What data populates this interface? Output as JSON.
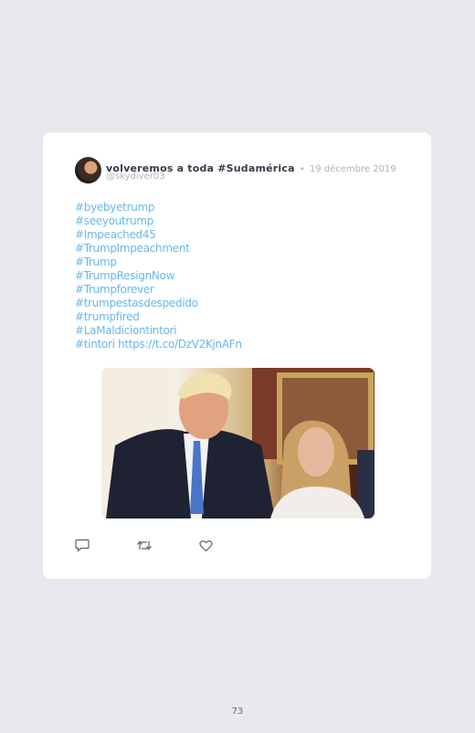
{
  "tweet": {
    "author_name": "volveremos a toda #Sudamérica",
    "separator": "•",
    "date": "19 décembre 2019",
    "handle": "@skydiver03",
    "hashtags": [
      "#byebyetrump",
      "#seeyoutrump",
      "#Impeached45",
      "#TrumpImpeachment",
      "#Trump",
      "#TrumpResignNow",
      "#Trumpforever",
      "#trumpestasdespedido",
      "#trumpfired",
      "#LaMaldiciontintori"
    ],
    "last_tag": "#tintori",
    "link": "https://t.co/DzV2KjnAFn",
    "icons": [
      "comment-icon",
      "retweet-icon",
      "like-icon"
    ]
  },
  "page": {
    "number": "73"
  }
}
